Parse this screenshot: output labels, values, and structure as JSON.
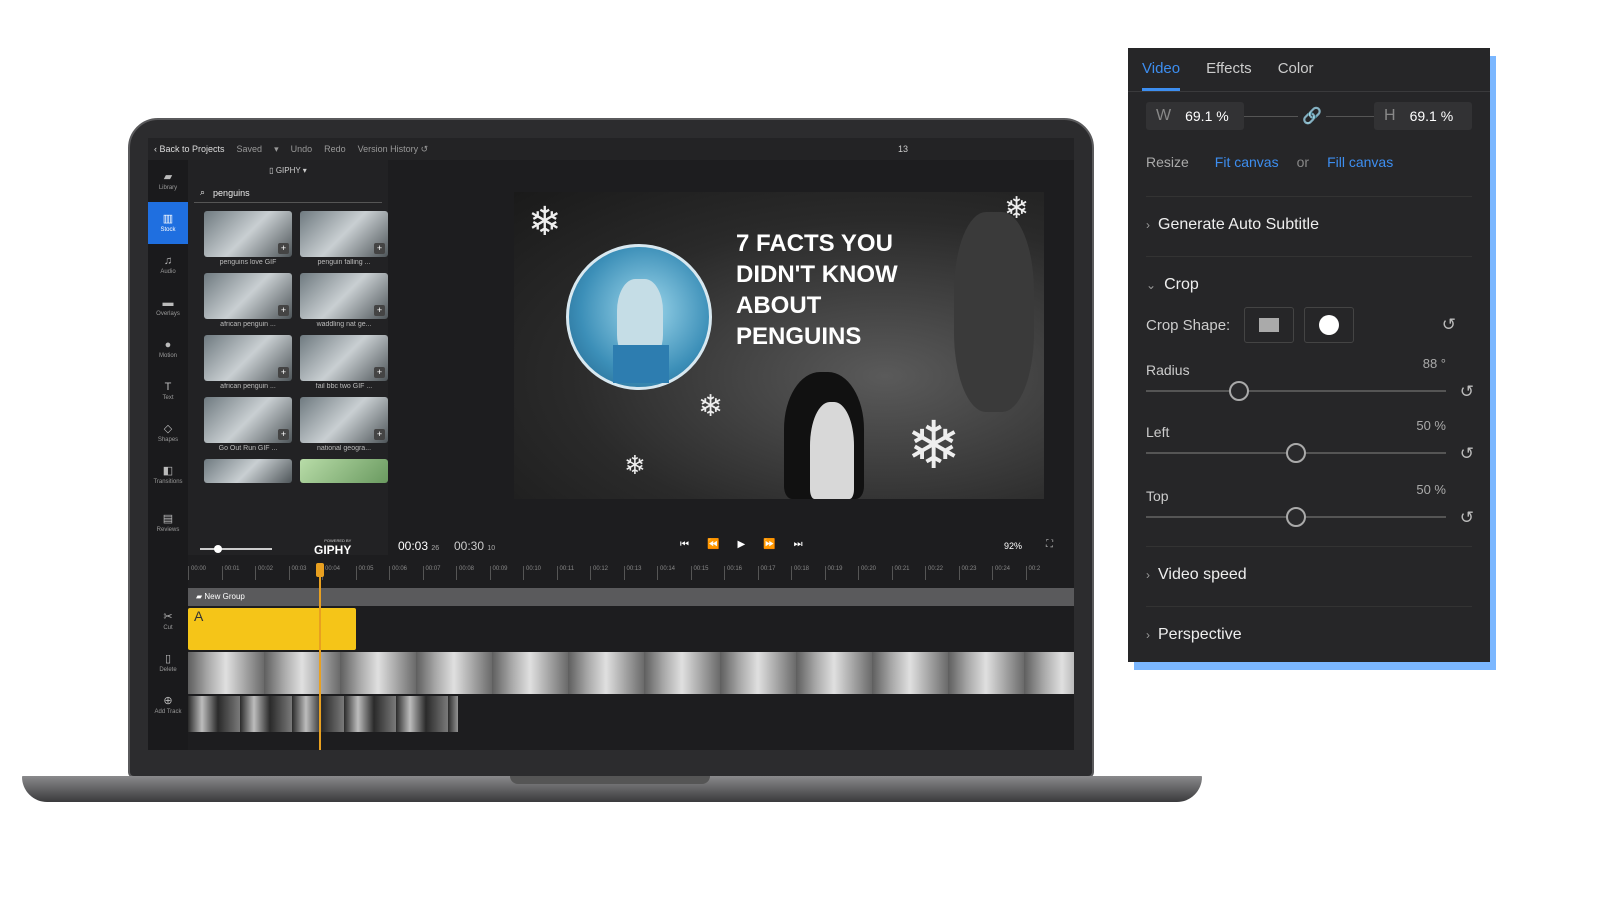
{
  "topbar": {
    "back": "Back to Projects",
    "saved": "Saved",
    "undo": "Undo",
    "redo": "Redo",
    "version": "Version History",
    "num": "13"
  },
  "leftbar": [
    {
      "label": "Library",
      "icon": "folder-icon"
    },
    {
      "label": "Stock",
      "icon": "stock-icon"
    },
    {
      "label": "Audio",
      "icon": "music-icon"
    },
    {
      "label": "Overlays",
      "icon": "overlay-icon"
    },
    {
      "label": "Motion",
      "icon": "motion-icon"
    },
    {
      "label": "Text",
      "icon": "text-icon"
    },
    {
      "label": "Shapes",
      "icon": "shapes-icon"
    },
    {
      "label": "Transitions",
      "icon": "transitions-icon"
    },
    {
      "label": "Reviews",
      "icon": "reviews-icon"
    }
  ],
  "tools": [
    {
      "label": "Cut"
    },
    {
      "label": "Delete"
    },
    {
      "label": "Add Track"
    }
  ],
  "source": "GIPHY",
  "search": "penguins",
  "thumbs": [
    "penguins love GIF",
    "penguin falling ...",
    "african penguin ...",
    "waddling nat ge...",
    "african penguin ...",
    "fail bbc two GIF ...",
    "Go Out Run GIF ...",
    "national geogra...",
    "",
    ""
  ],
  "giphy": {
    "powered": "POWERED BY",
    "brand": "GIPHY"
  },
  "preview": {
    "title": "7 FACTS YOU\nDIDN'T KNOW\nABOUT\nPENGUINS"
  },
  "controls": {
    "current": "00:03",
    "current_frame": "26",
    "total": "00:30",
    "total_frame": "10",
    "zoom": "92%"
  },
  "ruler": [
    "00:00",
    "00:01",
    "00:02",
    "00:03",
    "00:04",
    "00:05",
    "00:06",
    "00:07",
    "00:08",
    "00:09",
    "00:10",
    "00:11",
    "00:12",
    "00:13",
    "00:14",
    "00:15",
    "00:16",
    "00:17",
    "00:18",
    "00:19",
    "00:20",
    "00:21",
    "00:22",
    "00:23",
    "00:24",
    "00:2"
  ],
  "timeline": {
    "group": "New Group",
    "clip_letter": "A"
  },
  "props": {
    "tabs": [
      "Video",
      "Effects",
      "Color"
    ],
    "width": {
      "label": "W",
      "value": "69.1 %"
    },
    "height": {
      "label": "H",
      "value": "69.1 %"
    },
    "resize": {
      "label": "Resize",
      "fit": "Fit canvas",
      "or": "or",
      "fill": "Fill canvas"
    },
    "auto_subtitle": "Generate Auto Subtitle",
    "crop": "Crop",
    "crop_shape": "Crop Shape:",
    "radius": {
      "label": "Radius",
      "value": "88 °",
      "level": 0.31
    },
    "left": {
      "label": "Left",
      "value": "50 %",
      "level": 0.5
    },
    "top": {
      "label": "Top",
      "value": "50 %",
      "level": 0.5
    },
    "video_speed": "Video speed",
    "perspective": "Perspective"
  },
  "colors": {
    "accent": "#3d8ef0",
    "clip": "#f5c518",
    "playhead": "#e8a020"
  }
}
